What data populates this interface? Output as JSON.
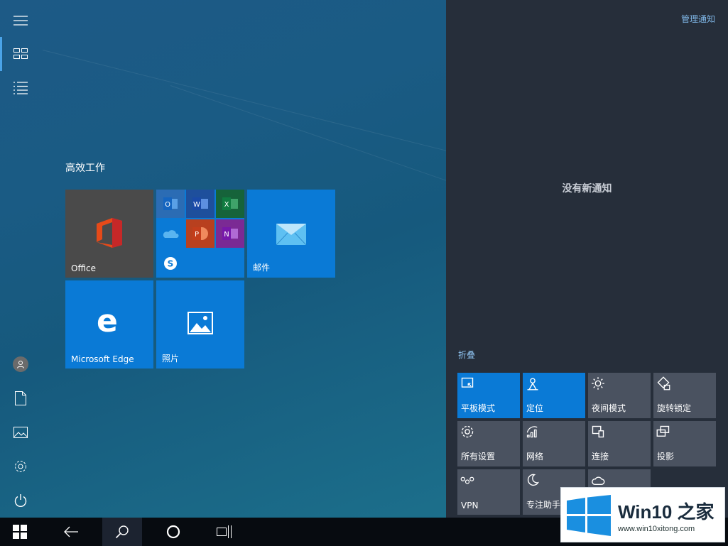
{
  "start": {
    "group_title": "高效工作",
    "tiles": {
      "office": {
        "label": "Office"
      },
      "mail": {
        "label": "邮件"
      },
      "edge": {
        "label": "Microsoft Edge"
      },
      "photos": {
        "label": "照片"
      }
    },
    "apps_folder": [
      "outlook-icon",
      "word-icon",
      "excel-icon",
      "onedrive-icon",
      "powerpoint-icon",
      "onenote-icon",
      "skype-icon"
    ]
  },
  "action_center": {
    "manage_label": "管理通知",
    "no_notifications": "没有新通知",
    "collapse_label": "折叠",
    "quick_actions": [
      {
        "label": "平板模式",
        "active": true,
        "icon": "tablet-mode-icon"
      },
      {
        "label": "定位",
        "active": true,
        "icon": "location-icon"
      },
      {
        "label": "夜间模式",
        "active": false,
        "icon": "night-light-icon"
      },
      {
        "label": "旋转锁定",
        "active": false,
        "icon": "rotation-lock-icon"
      },
      {
        "label": "所有设置",
        "active": false,
        "icon": "settings-icon"
      },
      {
        "label": "网络",
        "active": false,
        "icon": "network-icon"
      },
      {
        "label": "连接",
        "active": false,
        "icon": "connect-icon"
      },
      {
        "label": "投影",
        "active": false,
        "icon": "project-icon"
      },
      {
        "label": "VPN",
        "active": false,
        "icon": "vpn-icon"
      },
      {
        "label": "专注助手",
        "active": false,
        "icon": "focus-assist-icon"
      },
      {
        "label": "",
        "active": false,
        "icon": "weather-icon"
      }
    ]
  },
  "watermark": {
    "title": "Win10 之家",
    "url": "www.win10xitong.com"
  },
  "colors": {
    "accent": "#0a7ad6",
    "action_center_bg": "#262e3a",
    "tile_inactive": "#4a5260",
    "office_tile": "#4a4a4a"
  }
}
